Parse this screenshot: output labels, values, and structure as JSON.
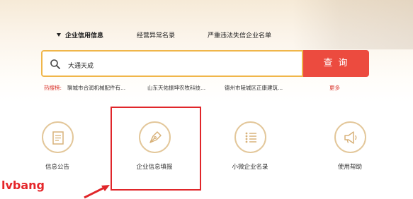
{
  "tabs": [
    {
      "label": "企业信用信息",
      "active": true
    },
    {
      "label": "经营异常名录",
      "active": false
    },
    {
      "label": "严重违法失信企业名单",
      "active": false
    }
  ],
  "search": {
    "value": "大通天成",
    "button_label": "查询",
    "icon": "search-icon"
  },
  "hot_search": {
    "label": "热搜榜:",
    "items": [
      "聊城市合润机械配件有...",
      "山东天佑振坤农牧科技...",
      "德州市陵城区正康建筑..."
    ],
    "more_label": "更多"
  },
  "functions": [
    {
      "label": "信息公告",
      "icon": "document-icon"
    },
    {
      "label": "企业信息填报",
      "icon": "pen-nib-icon"
    },
    {
      "label": "小微企业名录",
      "icon": "list-icon"
    },
    {
      "label": "使用帮助",
      "icon": "megaphone-icon"
    }
  ],
  "annotation": {
    "watermark": "lvbang"
  },
  "colors": {
    "accent_red": "#ec4b3f",
    "search_border": "#f0b64a",
    "icon_gold": "#d8b27a",
    "highlight_red": "#e0262a"
  }
}
